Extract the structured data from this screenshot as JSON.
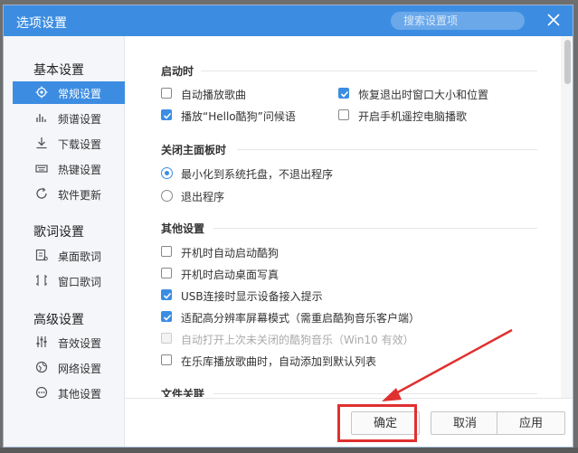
{
  "window": {
    "title": "选项设置",
    "search_placeholder": "搜索设置项"
  },
  "sidebar": {
    "groups": [
      {
        "title": "基本设置",
        "items": [
          {
            "label": "常规设置",
            "icon": "gear-icon",
            "active": true
          },
          {
            "label": "频谱设置",
            "icon": "spectrum-icon"
          },
          {
            "label": "下载设置",
            "icon": "download-icon"
          },
          {
            "label": "热键设置",
            "icon": "keyboard-icon"
          },
          {
            "label": "软件更新",
            "icon": "update-icon"
          }
        ]
      },
      {
        "title": "歌词设置",
        "items": [
          {
            "label": "桌面歌词",
            "icon": "desktop-lyrics-icon"
          },
          {
            "label": "窗口歌词",
            "icon": "window-lyrics-icon"
          }
        ]
      },
      {
        "title": "高级设置",
        "items": [
          {
            "label": "音效设置",
            "icon": "equalizer-icon"
          },
          {
            "label": "网络设置",
            "icon": "network-icon"
          },
          {
            "label": "其他设置",
            "icon": "more-icon"
          }
        ]
      }
    ]
  },
  "content": {
    "startup": {
      "title": "启动时",
      "options": [
        {
          "label": "自动播放歌曲",
          "checked": false
        },
        {
          "label": "恢复退出时窗口大小和位置",
          "checked": true
        },
        {
          "label": "播放“Hello酷狗”问候语",
          "checked": true
        },
        {
          "label": "开启手机遥控电脑播歌",
          "checked": false
        }
      ]
    },
    "close_panel": {
      "title": "关闭主面板时",
      "options": [
        {
          "label": "最小化到系统托盘，不退出程序",
          "selected": true
        },
        {
          "label": "退出程序",
          "selected": false
        }
      ]
    },
    "other": {
      "title": "其他设置",
      "options": [
        {
          "label": "开机时自动启动酷狗",
          "checked": false
        },
        {
          "label": "开机时启动桌面写真",
          "checked": false
        },
        {
          "label": "USB连接时显示设备接入提示",
          "checked": true
        },
        {
          "label": "适配高分辨率屏幕模式（需重启酷狗音乐客户端）",
          "checked": true
        },
        {
          "label": "自动打开上次未关闭的酷狗音乐（Win10 有效）",
          "checked": false,
          "disabled": true
        },
        {
          "label": "在乐库播放歌曲时，自动添加到默认列表",
          "checked": false
        }
      ]
    },
    "file_assoc": {
      "title": "文件关联"
    }
  },
  "footer": {
    "ok": "确定",
    "cancel": "取消",
    "apply": "应用"
  },
  "colors": {
    "accent": "#3c8de2",
    "annotation": "#e03030"
  }
}
